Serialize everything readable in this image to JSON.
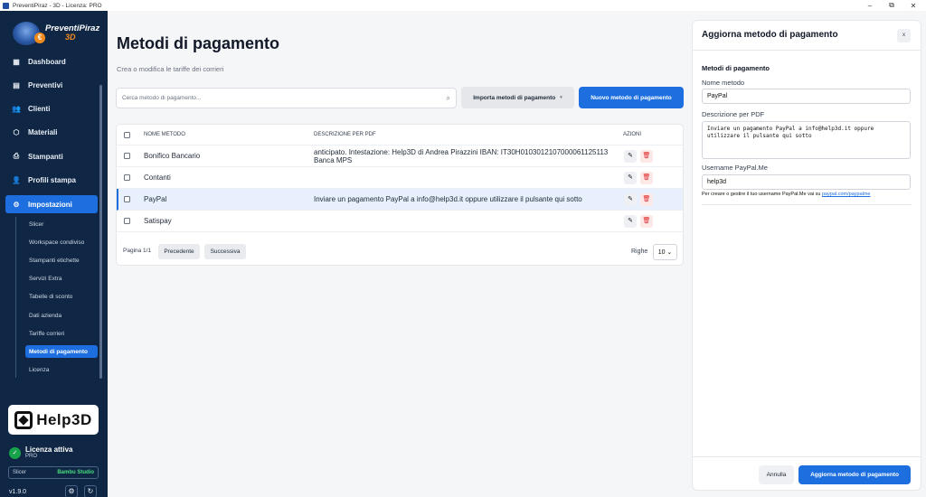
{
  "window": {
    "title": "PreventiPiraz - 3D - Licenza: PRO",
    "minimize": "–",
    "restore": "⧉",
    "close": "✕"
  },
  "sidebar": {
    "brand": "PreventiPiraz",
    "brand_3d": "3D",
    "euro": "€",
    "nav": [
      {
        "label": "Dashboard",
        "icon": "dashboard-icon"
      },
      {
        "label": "Preventivi",
        "icon": "document-icon"
      },
      {
        "label": "Clienti",
        "icon": "users-icon"
      },
      {
        "label": "Materiali",
        "icon": "cube-icon"
      },
      {
        "label": "Stampanti",
        "icon": "printer-icon"
      },
      {
        "label": "Profili stampa",
        "icon": "user-icon"
      },
      {
        "label": "Impostazioni",
        "icon": "gear-icon"
      }
    ],
    "sub": [
      "Slicer",
      "Workspace condiviso",
      "Stampanti etichette",
      "Servizi Extra",
      "Tabelle di sconto",
      "Dati azienda",
      "Tariffe corrieri",
      "Metodi di pagamento",
      "Licenza"
    ],
    "help3d": "Help3D",
    "license_title": "Licenza attiva",
    "license_plan": "PRO",
    "slicer_label": "Slicer",
    "slicer_value": "Bambu Studio",
    "version": "v1.9.0"
  },
  "main": {
    "title": "Metodi di pagamento",
    "subtitle": "Crea o modifica le tariffe dei corrieri",
    "search_placeholder": "Cerca metodo di pagamento...",
    "import_label": "Importa metodi di pagamento",
    "new_label": "Nuovo metodo di pagamento",
    "table": {
      "headers": {
        "name": "NOME METODO",
        "desc": "DESCRIZIONE PER PDF",
        "actions": "AZIONI"
      },
      "rows": [
        {
          "name": "Bonifico Bancario",
          "desc": "anticipato. Intestazione: Help3D di Andrea Pirazzini IBAN: IT30H0103012107000061125113 Banca MPS"
        },
        {
          "name": "Contanti",
          "desc": ""
        },
        {
          "name": "PayPal",
          "desc": "Inviare un pagamento PayPal a info@help3d.it oppure utilizzare il pulsante qui sotto"
        },
        {
          "name": "Satispay",
          "desc": ""
        }
      ]
    },
    "pager": {
      "page": "Pagina 1/1",
      "prev": "Precedente",
      "next": "Successiva",
      "rows_label": "Righe",
      "rows_value": "10 ⌄"
    }
  },
  "panel": {
    "title": "Aggiorna metodo di pagamento",
    "close": "x",
    "section": "Metodi di pagamento",
    "name_label": "Nome metodo",
    "name_value": "PayPal",
    "desc_label": "Descrizione per PDF",
    "desc_value": "Inviare un pagamento PayPal a info@help3d.it oppure utilizzare il pulsante qui sotto",
    "user_label": "Username PayPal.Me",
    "user_value": "help3d",
    "help_text": "Per creare o gestire il tuo username PayPal.Me vai su ",
    "help_link": "paypal.com/paypalme",
    "cancel": "Annulla",
    "submit": "Aggiorna metodo di pagamento"
  }
}
